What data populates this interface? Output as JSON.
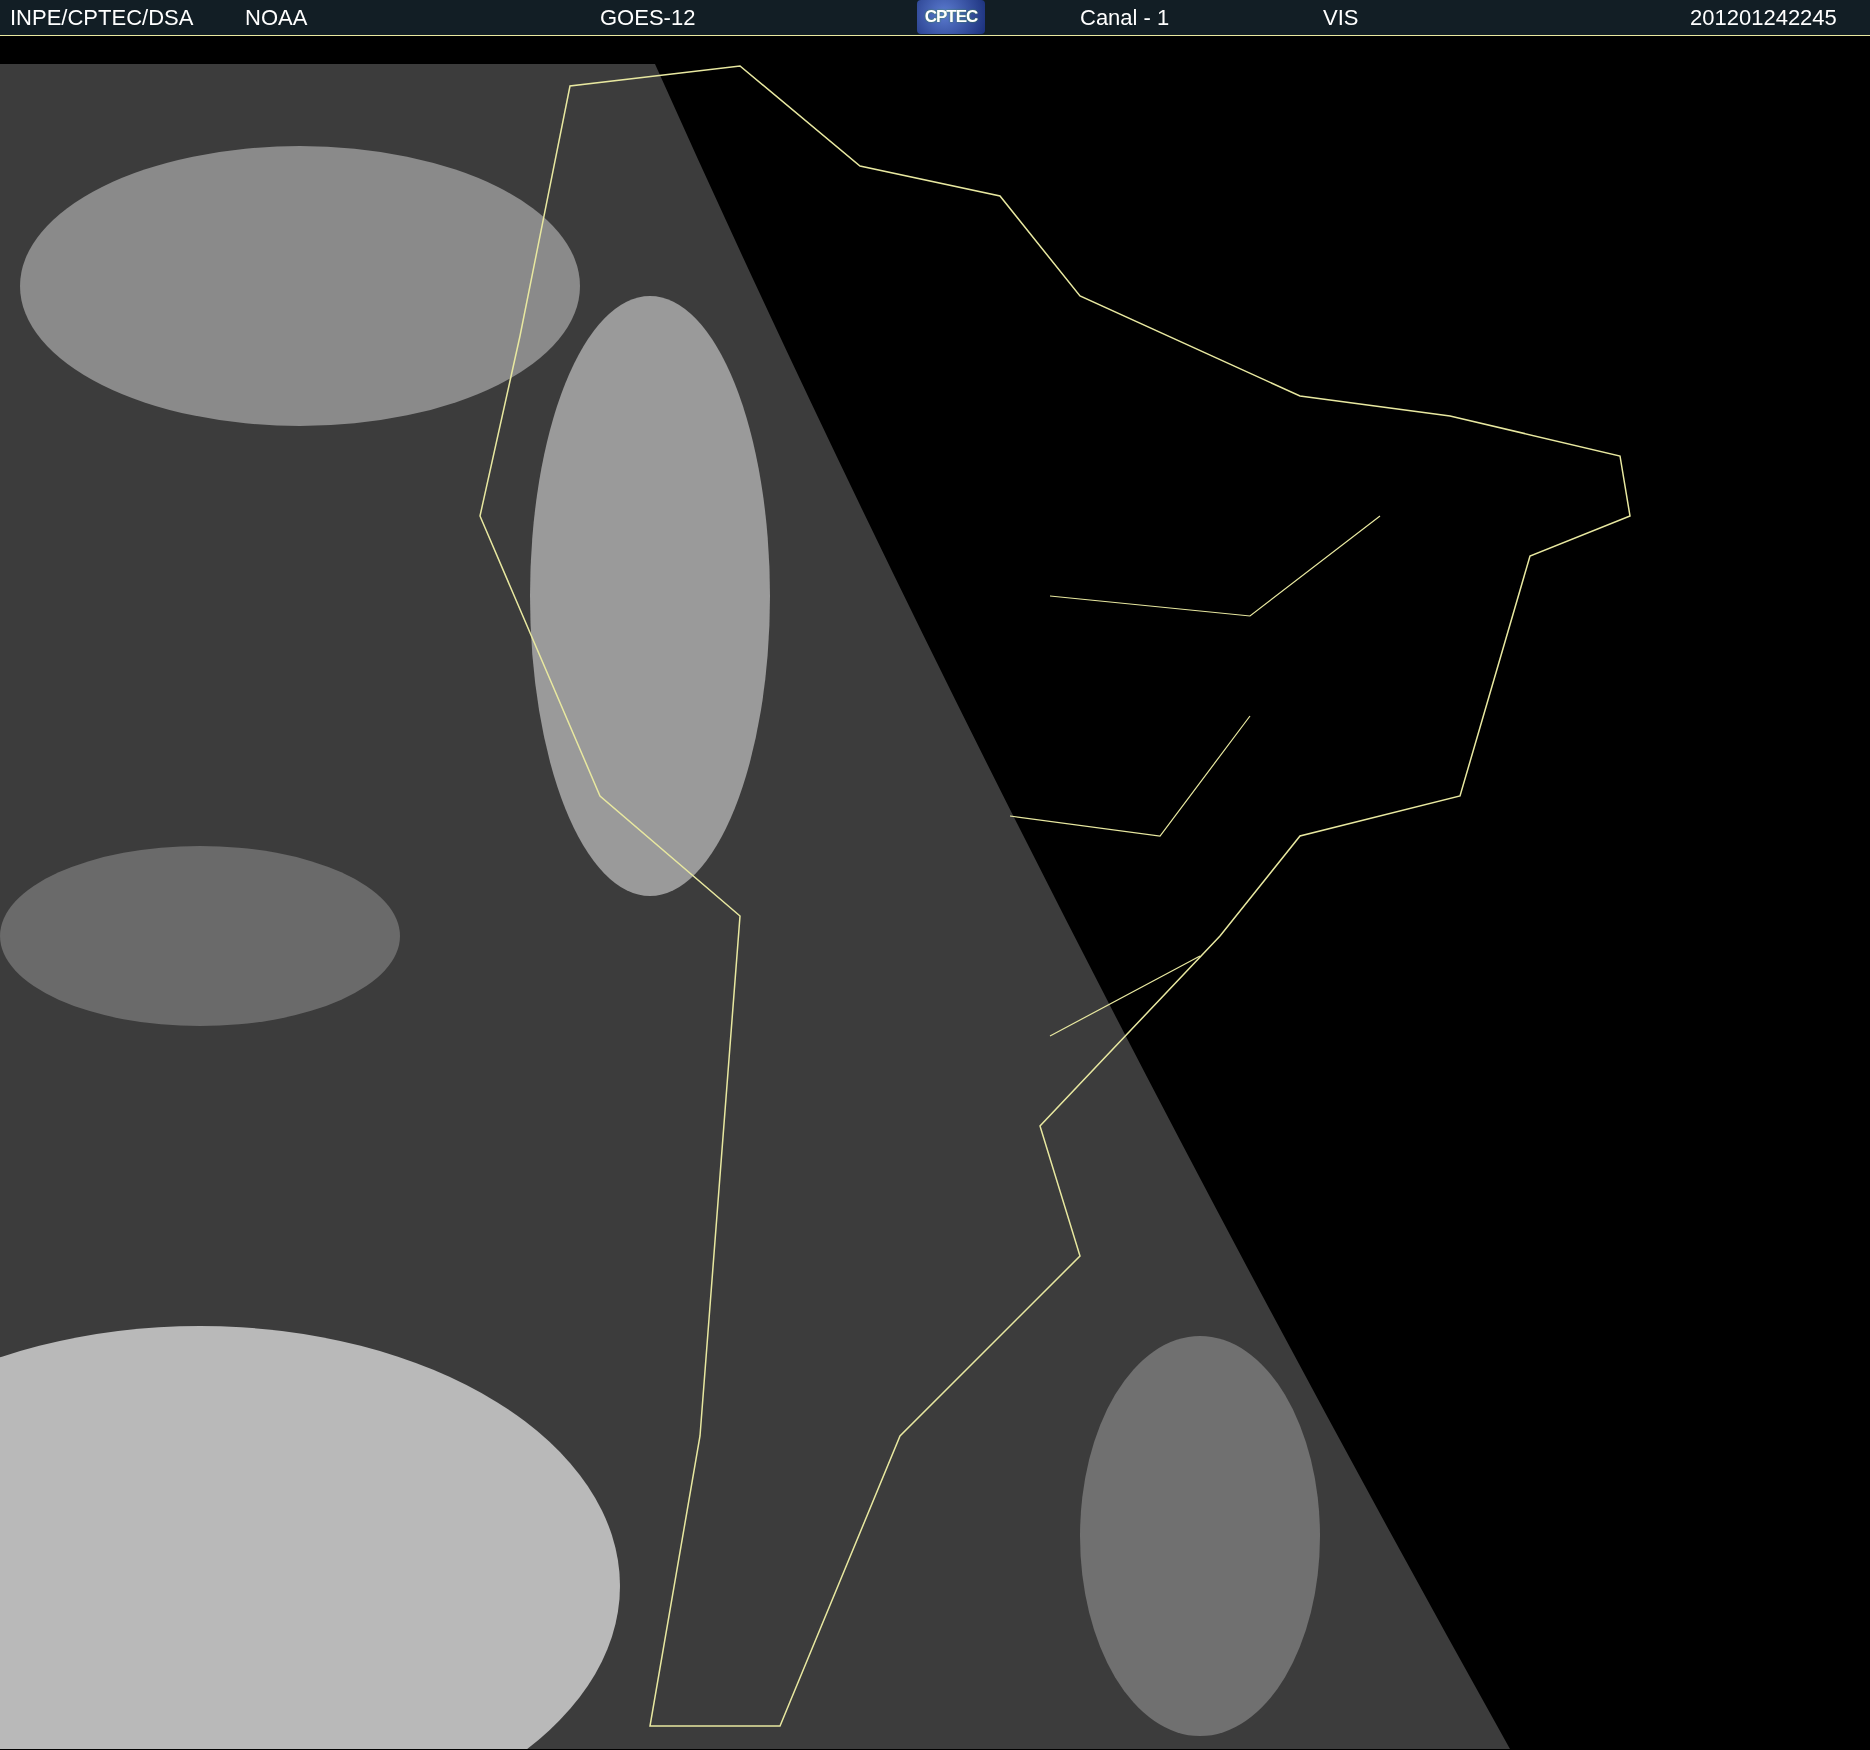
{
  "header": {
    "items": [
      {
        "kind": "text",
        "text": "INPE/CPTEC/DSA"
      },
      {
        "kind": "text",
        "text": "NOAA"
      },
      {
        "kind": "text",
        "text": "GOES-12"
      },
      {
        "kind": "logo",
        "text": "CPTEC"
      },
      {
        "kind": "text",
        "text": "Canal - 1"
      },
      {
        "kind": "text",
        "text": "VIS"
      },
      {
        "kind": "text",
        "text": "201201242245"
      }
    ]
  }
}
